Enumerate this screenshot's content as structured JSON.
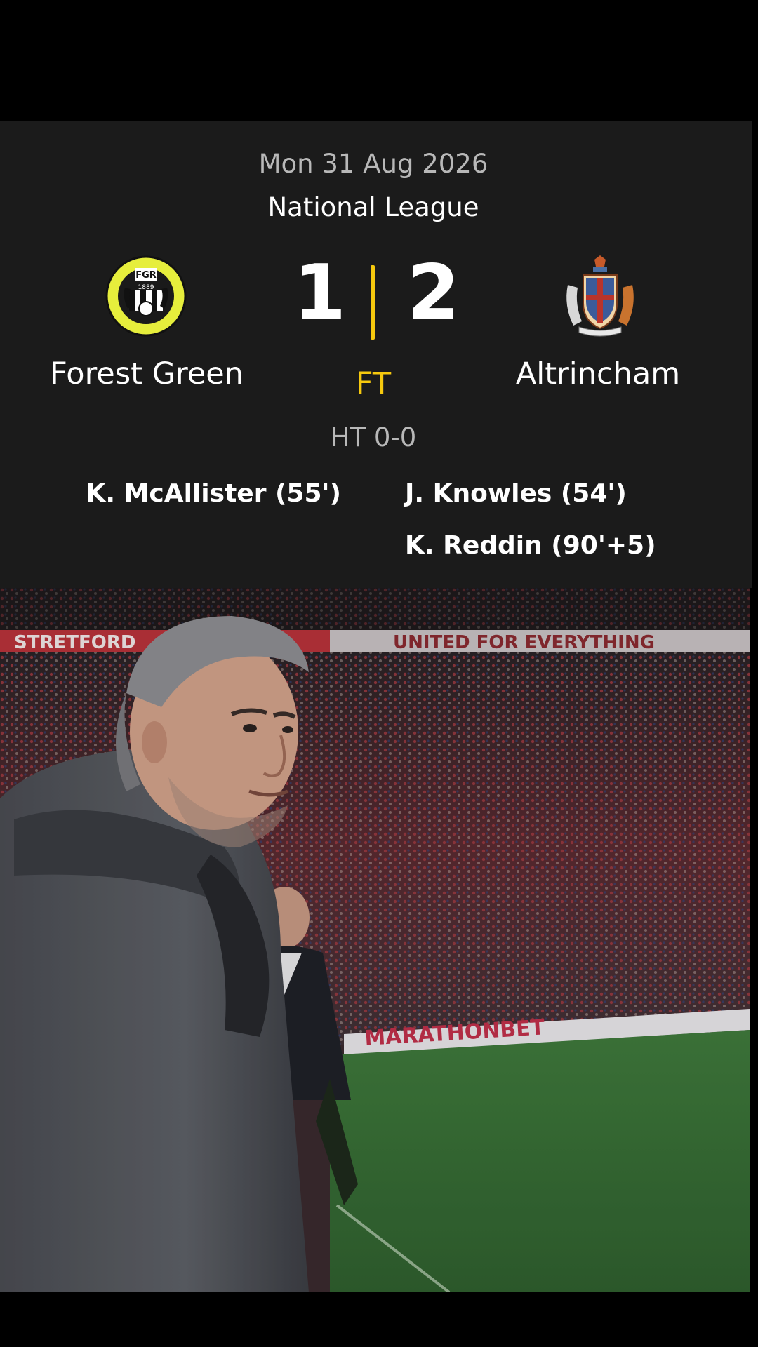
{
  "match": {
    "date": "Mon 31 Aug 2026",
    "competition": "National League",
    "home_team": "Forest Green",
    "away_team": "Altrincham",
    "home_score": "1",
    "away_score": "2",
    "status": "FT",
    "half_time": "HT 0-0",
    "home_scorers": [
      "K. McAllister (55')"
    ],
    "away_scorers": [
      "J. Knowles (54')",
      "K. Reddin (90'+5)"
    ]
  },
  "crests": {
    "home_icon": "forest-green-rovers-crest",
    "home_text": "FGR",
    "home_year": "1889",
    "away_icon": "altrincham-coat-of-arms"
  },
  "colors": {
    "panel_bg": "#1b1b1b",
    "accent": "#f6c90e",
    "muted_text": "#b8b8b8",
    "crest_yellow": "#e6ee3c"
  },
  "video": {
    "banner_text_top": "STRETFORD",
    "banner_text_stand": "UNITED FOR EVERYTHING",
    "hoarding_text": "MARATHONBET"
  }
}
